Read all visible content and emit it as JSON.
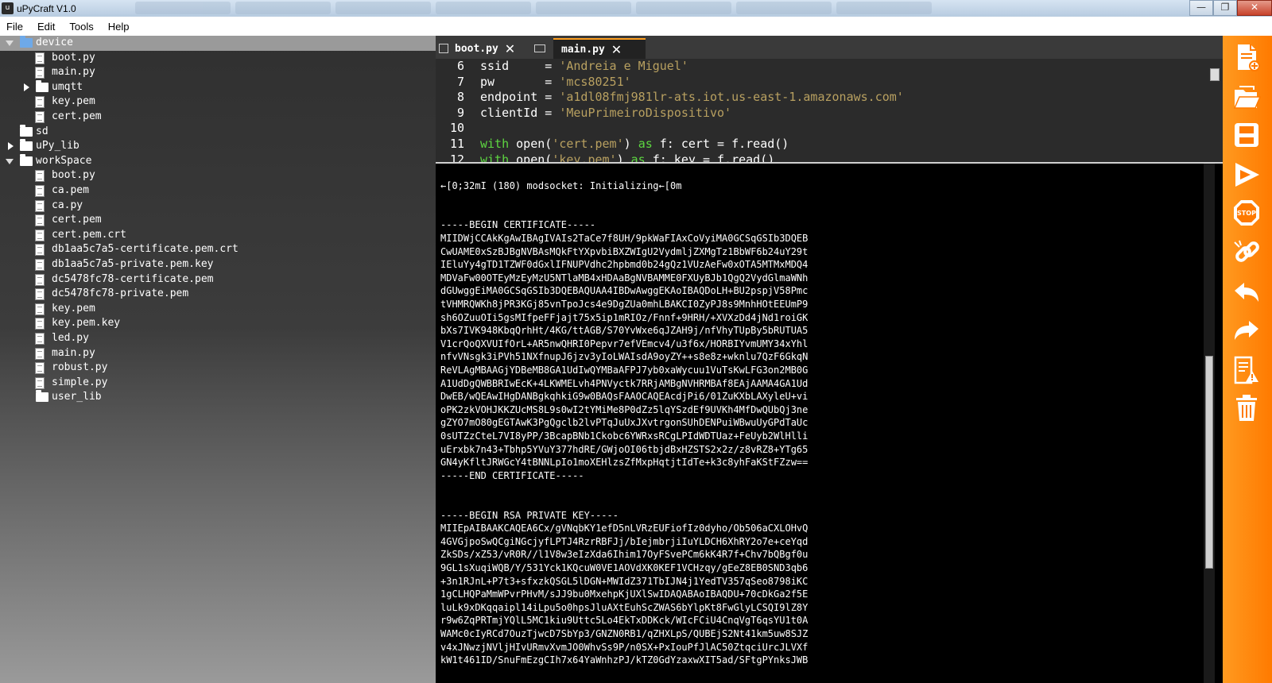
{
  "window": {
    "title": "uPyCraft V1.0",
    "buttons": {
      "minimize": "—",
      "maximize": "❐",
      "close": "✕"
    }
  },
  "menu": [
    "File",
    "Edit",
    "Tools",
    "Help"
  ],
  "tree": [
    {
      "label": "device",
      "type": "folder",
      "expanded": true,
      "depth": 0,
      "selected": true
    },
    {
      "label": "boot.py",
      "type": "file",
      "depth": 1
    },
    {
      "label": "main.py",
      "type": "file",
      "depth": 1
    },
    {
      "label": "umqtt",
      "type": "folder",
      "expanded": false,
      "depth": 1
    },
    {
      "label": "key.pem",
      "type": "file",
      "depth": 1
    },
    {
      "label": "cert.pem",
      "type": "file",
      "depth": 1
    },
    {
      "label": "sd",
      "type": "folder",
      "depth": 0
    },
    {
      "label": "uPy_lib",
      "type": "folder",
      "expanded": false,
      "depth": 0
    },
    {
      "label": "workSpace",
      "type": "folder",
      "expanded": true,
      "depth": 0
    },
    {
      "label": "boot.py",
      "type": "file",
      "depth": 1
    },
    {
      "label": "ca.pem",
      "type": "file",
      "depth": 1
    },
    {
      "label": "ca.py",
      "type": "file",
      "depth": 1
    },
    {
      "label": "cert.pem",
      "type": "file",
      "depth": 1
    },
    {
      "label": "cert.pem.crt",
      "type": "file",
      "depth": 1
    },
    {
      "label": "db1aa5c7a5-certificate.pem.crt",
      "type": "file",
      "depth": 1
    },
    {
      "label": "db1aa5c7a5-private.pem.key",
      "type": "file",
      "depth": 1
    },
    {
      "label": "dc5478fc78-certificate.pem",
      "type": "file",
      "depth": 1
    },
    {
      "label": "dc5478fc78-private.pem",
      "type": "file",
      "depth": 1
    },
    {
      "label": "key.pem",
      "type": "file",
      "depth": 1
    },
    {
      "label": "key.pem.key",
      "type": "file",
      "depth": 1
    },
    {
      "label": "led.py",
      "type": "file",
      "depth": 1
    },
    {
      "label": "main.py",
      "type": "file",
      "depth": 1
    },
    {
      "label": "robust.py",
      "type": "file",
      "depth": 1
    },
    {
      "label": "simple.py",
      "type": "file",
      "depth": 1
    },
    {
      "label": "user_lib",
      "type": "folder",
      "depth": 1
    }
  ],
  "tabs": [
    {
      "label": "boot.py",
      "active": false,
      "close": "✕"
    },
    {
      "label": "main.py",
      "active": true,
      "close": "✕"
    }
  ],
  "code": [
    {
      "n": "6",
      "parts": [
        [
          "t",
          "ssid     = "
        ],
        [
          "s",
          "'Andreia e Miguel'"
        ]
      ]
    },
    {
      "n": "7",
      "parts": [
        [
          "t",
          "pw       = "
        ],
        [
          "s",
          "'mcs80251'"
        ]
      ]
    },
    {
      "n": "8",
      "parts": [
        [
          "t",
          "endpoint = "
        ],
        [
          "s",
          "'a1dl08fmj981lr-ats.iot.us-east-1.amazonaws.com'"
        ]
      ]
    },
    {
      "n": "9",
      "parts": [
        [
          "t",
          "clientId = "
        ],
        [
          "s",
          "'MeuPrimeiroDispositivo'"
        ]
      ]
    },
    {
      "n": "10",
      "parts": []
    },
    {
      "n": "11",
      "parts": [
        [
          "k",
          "with"
        ],
        [
          "t",
          " open("
        ],
        [
          "s",
          "'cert.pem'"
        ],
        [
          "t",
          ") "
        ],
        [
          "k",
          "as"
        ],
        [
          "t",
          " f: cert = f.read()"
        ]
      ]
    },
    {
      "n": "12",
      "parts": [
        [
          "k",
          "with"
        ],
        [
          "t",
          " open("
        ],
        [
          "s",
          "'key.pem'"
        ],
        [
          "t",
          ") "
        ],
        [
          "k",
          "as"
        ],
        [
          "t",
          " f: key = f.read()"
        ]
      ]
    }
  ],
  "terminal": [
    "",
    "←[0;32mI (180) modsocket: Initializing←[0m",
    "",
    "",
    "-----BEGIN CERTIFICATE-----",
    "MIIDWjCCAkKgAwIBAgIVAIs2TaCe7f8UH/9pkWaFIAxCoVyiMA0GCSqGSIb3DQEB",
    "CwUAME0xSzBJBgNVBAsMQkFtYXpvbiBXZWIgU2VydmljZXMgTz1BbWF6b24uY29t",
    "IEluYy4gTD1TZWF0dGxlIFNUPVdhc2hpbmd0b24gQz1VUzAeFw0xOTA5MTMxMDQ4",
    "MDVaFw00OTEyMzEyMzU5NTlaMB4xHDAaBgNVBAMME0FXUyBJb1QgQ2VydGlmaWNh",
    "dGUwggEiMA0GCSqGSIb3DQEBAQUAA4IBDwAwggEKAoIBAQDoLH+BU2pspjV58Pmc",
    "tVHMRQWKh8jPR3KGj85vnTpoJcs4e9DgZUa0mhLBAKCI0ZyPJ8s9MnhHOtEEUmP9",
    "sh6OZuuOIi5gsMIfpeFFjajt75x5ip1mRIOz/Fnnf+9HRH/+XVXzDd4jNd1roiGK",
    "bXs7IVK948KbqQrhHt/4KG/ttAGB/S70YvWxe6qJZAH9j/nfVhyTUpBy5bRUTUA5",
    "V1crQoQXVUIfOrL+AR5nwQHRI0Pepvr7efVEmcv4/u3f6x/HORBIYvmUMY34xYhl",
    "nfvVNsgk3iPVh51NXfnupJ6jzv3yIoLWAIsdA9oyZY++s8e8z+wknlu7QzF6GkqN",
    "ReVLAgMBAAGjYDBeMB8GA1UdIwQYMBaAFPJ7yb0xaWycuu1VuTsKwLFG3on2MB0G",
    "A1UdDgQWBBRIwEcK+4LKWMELvh4PNVyctk7RRjAMBgNVHRMBAf8EAjAAMA4GA1Ud",
    "DwEB/wQEAwIHgDANBgkqhkiG9w0BAQsFAAOCAQEAcdjPi6/01ZuKXbLAXyleU+vi",
    "oPK2zkVOHJKKZUcMS8L9s0wI2tYMiMe8P0dZz5lqYSzdEf9UVKh4MfDwQUbQj3ne",
    "gZYO7mO80gEGTAwK3PgQgclb2lvPTqJuUxJXvtrgonSUhDENPuiWBwuUyGPdTaUc",
    "0sUTZzCteL7VI8yPP/3BcapBNb1Ckobc6YWRxsRCgLPIdWDTUaz+FeUyb2WlHlli",
    "uErxbk7n43+Tbhp5YVuY377hdRE/GWjoOI06tbjdBxHZSTS2x2z/z8vRZ8+YTg65",
    "GN4yKfltJRWGcY4tBNNLpIo1moXEHlzsZfMxpHqtjtIdTe+k3c8yhFaKStFZzw==",
    "-----END CERTIFICATE-----",
    "",
    "",
    "-----BEGIN RSA PRIVATE KEY-----",
    "MIIEpAIBAAKCAQEA6Cx/gVNqbKY1efD5nLVRzEUFiofIz0dyho/Ob506aCXLOHvQ",
    "4GVGjpoSwQCgiNGcjyfLPTJ4RzrRBFJj/bIejmbrjiIuYLDCH6XhRY2o7e+ceYqd",
    "ZkSDs/xZ53/vR0R//l1V8w3eIzXda6Ihim17OyFSvePCm6kK4R7f+Chv7bQBgf0u",
    "9GL1sXuqiWQB/Y/531Yck1KQcuW0VE1AOVdXK0KEF1VCHzqy/gEeZ8EB0SND3qb6",
    "+3n1RJnL+P7t3+sfxzkQSGL5lDGN+MWIdZ371TbIJN4j1YedTV357qSeo8798iKC",
    "1gCLHQPaMmWPvrPHvM/sJJ9bu0MxehpKjUXlSwIDAQABAoIBAQDU+70cDkGa2f5E",
    "luLk9xDKqqaipl14iLpu5o0hpsJluAXtEuhScZWAS6bYlpKt8FwGlyLCSQI9lZ8Y",
    "r9w6ZqPRTmjYQlL5MC1kiu9Uttc5Lo4EkTxDDKck/WIcFCiU4CnqVgT6qsYU1t0A",
    "WAMc0cIyRCd7OuzTjwcD7SbYp3/GNZN0RB1/qZHXLpS/QUBEjS2Nt41km5uw8SJZ",
    "v4xJNwzjNVljHIvURmvXvmJO0WhvSs9P/n0SX+PxIouPfJlAC50ZtqciUrcJLVXf",
    "kW1t461ID/SnuFmEzgCIh7x64YaWnhzPJ/kTZ0GdYzaxwXIT5ad/SFtgPYnksJWB"
  ],
  "toolbar": [
    "new-file-icon",
    "open-folder-icon",
    "save-icon",
    "run-icon",
    "stop-icon",
    "connect-icon",
    "undo-icon",
    "redo-icon",
    "syntax-check-icon",
    "clear-trash-icon"
  ]
}
